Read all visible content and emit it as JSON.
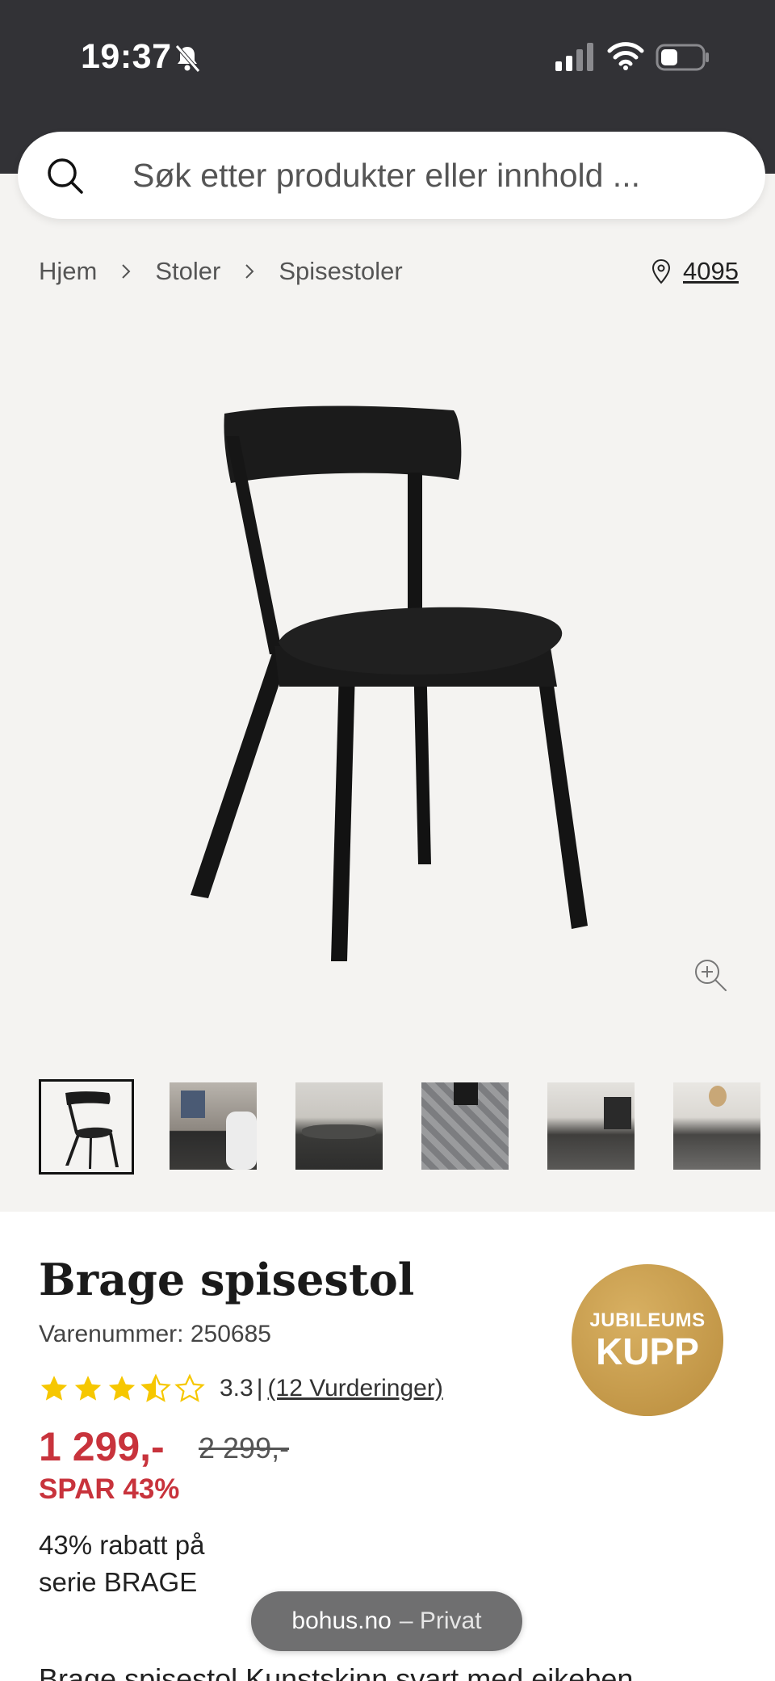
{
  "status_bar": {
    "time": "19:37"
  },
  "search": {
    "placeholder": "Søk etter produkter eller innhold ..."
  },
  "breadcrumb": {
    "items": [
      "Hjem",
      "Stoler",
      "Spisestoler"
    ]
  },
  "store": {
    "code": "4095"
  },
  "product": {
    "title": "Brage spisestol",
    "sku": "Varenummer: 250685",
    "rating": "3.3",
    "rating_sep": "|",
    "rating_stars": 3.3,
    "reviews": "(12 Vurderinger)",
    "price": "1 299,-",
    "old_price": "2 299,-",
    "save": "SPAR 43%",
    "promo": "43% rabatt på serie BRAGE",
    "description": "Brage spisestol Kunstskinn svart med eikeben"
  },
  "badge": {
    "line1": "JUBILEUMS",
    "line2": "KUPP"
  },
  "browser": {
    "domain": "bohus.no",
    "mode": "– Privat"
  },
  "colors": {
    "accent_red": "#c8333c",
    "star": "#f6c700",
    "badge_gold": "#c79a4a",
    "status_bar": "#323236"
  }
}
